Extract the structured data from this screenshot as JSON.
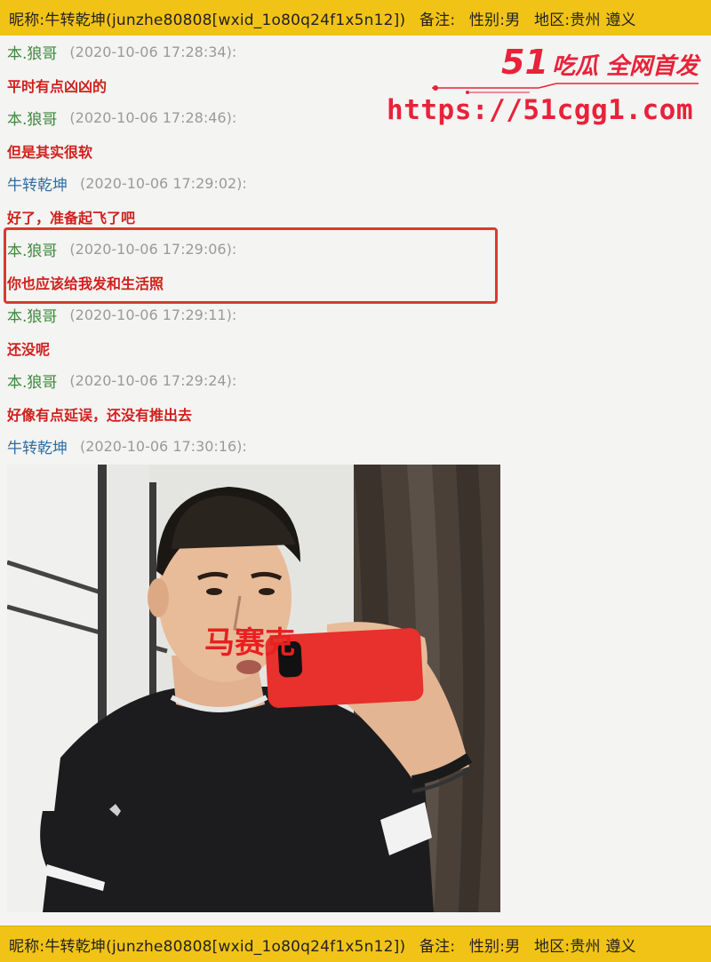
{
  "info_bar": {
    "nickname_label": "昵称:",
    "nickname_value": "牛转乾坤(junzhe80808[wxid_1o80q24f1x5n12])",
    "remark_label": "备注:",
    "gender_label": "性别:",
    "gender_value": "男",
    "region_label": "地区:",
    "region_value": "贵州 遵义"
  },
  "messages": [
    {
      "sender": "本.狼哥",
      "time": "(2020-10-06 17:28:34):",
      "text": "平时有点凶凶的",
      "color": "#3b8a3b"
    },
    {
      "sender": "本.狼哥",
      "time": "(2020-10-06 17:28:46):",
      "text": "但是其实很软",
      "color": "#3b8a3b"
    },
    {
      "sender": "牛转乾坤",
      "time": "(2020-10-06 17:29:02):",
      "text": "好了，准备起飞了吧",
      "color": "#2e6da4"
    },
    {
      "sender": "本.狼哥",
      "time": "(2020-10-06 17:29:06):",
      "text": "你也应该给我发和生活照",
      "color": "#3b8a3b"
    },
    {
      "sender": "本.狼哥",
      "time": "(2020-10-06 17:29:11):",
      "text": "还没呢",
      "color": "#3b8a3b"
    },
    {
      "sender": "本.狼哥",
      "time": "(2020-10-06 17:29:24):",
      "text": "好像有点延误，还没有推出去",
      "color": "#3b8a3b"
    },
    {
      "sender": "牛转乾坤",
      "time": "(2020-10-06 17:30:16):",
      "text": "",
      "color": "#2e6da4"
    }
  ],
  "watermark": {
    "brand_number": "51",
    "brand_text": "吃瓜 全网首发",
    "url": "https://51cgg1.com",
    "color": "#e8223a"
  },
  "photo_overlay_text": "马赛克",
  "colors": {
    "info_bar_bg": "#f2c317",
    "highlight_border": "#d83a32",
    "message_text": "#d0201d",
    "timestamp": "#9a9a9a",
    "phone_case": "#e8302c"
  }
}
